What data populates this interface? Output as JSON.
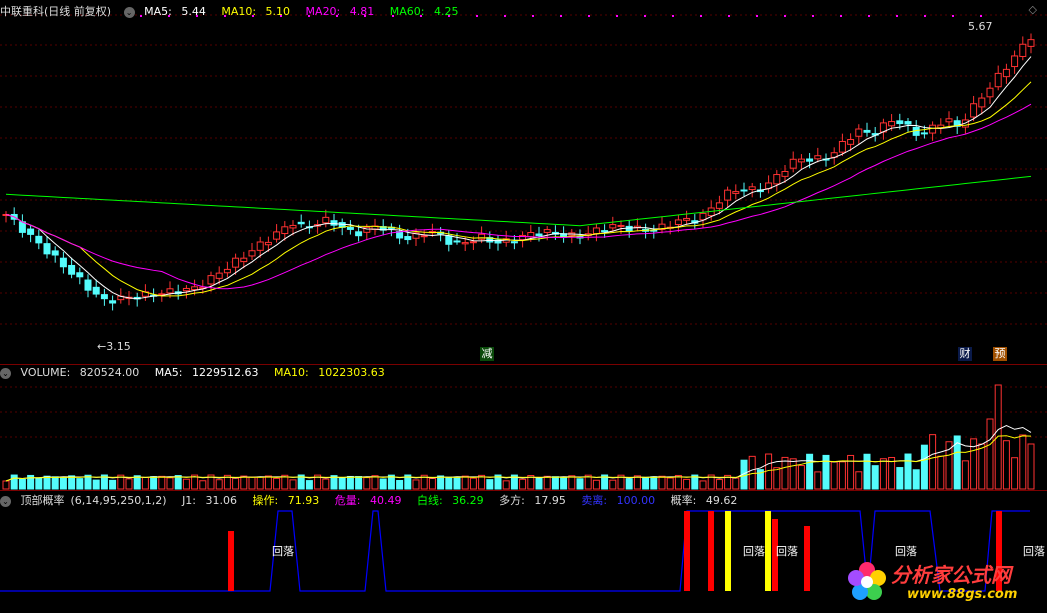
{
  "main_panel": {
    "stock_name": "中联重科",
    "period": "(日线 前复权)",
    "ma5_label": "MA5:",
    "ma5_value": "5.44",
    "ma10_label": "MA10:",
    "ma10_value": "5.10",
    "ma20_label": "MA20:",
    "ma20_value": "4.81",
    "ma60_label": "MA60:",
    "ma60_value": "4.25",
    "high_label": "5.67",
    "low_label": "3.15",
    "marker_reduce": "减",
    "marker_finance": "财",
    "marker_forecast": "预"
  },
  "volume_panel": {
    "label": "VOLUME:",
    "value": "820524.00",
    "ma5_label": "MA5:",
    "ma5_value": "1229512.63",
    "ma10_label": "MA10:",
    "ma10_value": "1022303.63"
  },
  "indicator_panel": {
    "name": "顶部概率",
    "params": "(6,14,95,250,1,2)",
    "j1_label": "J1:",
    "j1_value": "31.06",
    "op_label": "操作:",
    "op_value": "71.93",
    "danger_label": "危量:",
    "danger_value": "40.49",
    "white_label": "白线:",
    "white_value": "36.29",
    "long_label": "多方:",
    "long_value": "17.95",
    "sell_label": "卖离:",
    "sell_value": "100.00",
    "prob_label": "概率:",
    "prob_value": "49.62",
    "pullback_label": "回落"
  },
  "watermark": {
    "text": "分析家公式网",
    "url": "www.88gs.com"
  },
  "colors": {
    "up": "#ff3232",
    "down": "#54fcfc",
    "ma5": "#ffffff",
    "ma10": "#ffff00",
    "ma20": "#ff00ff",
    "ma60": "#00ff00",
    "grid": "#7a0000",
    "line": "#0000ff"
  }
}
